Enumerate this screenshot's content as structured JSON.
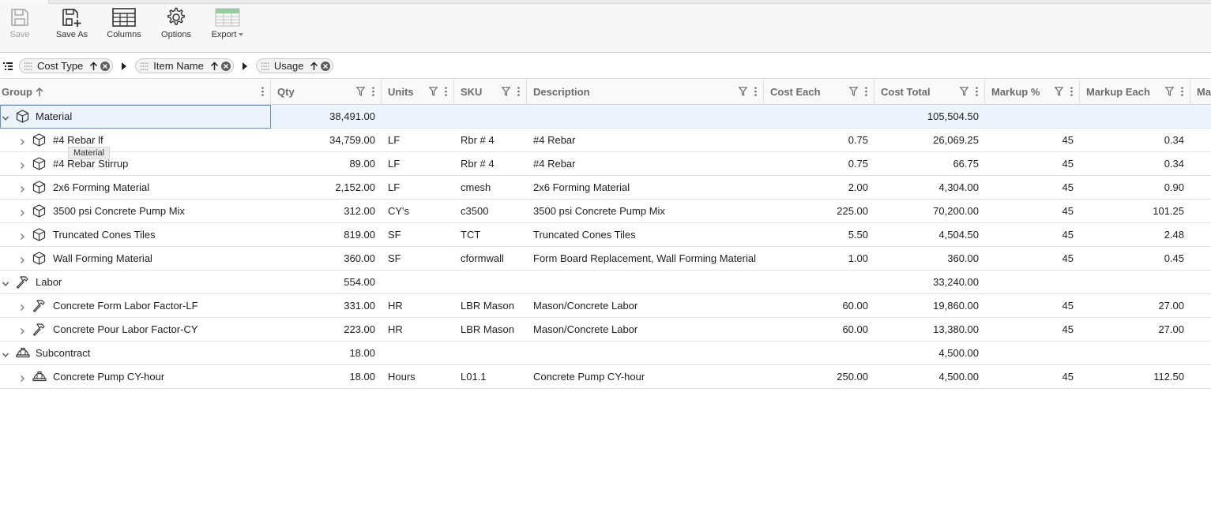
{
  "toolbar": {
    "save": "Save",
    "save_as": "Save As",
    "columns": "Columns",
    "options": "Options",
    "export": "Export"
  },
  "grouping": {
    "chips": [
      {
        "label": "Cost Type"
      },
      {
        "label": "Item Name"
      },
      {
        "label": "Usage"
      }
    ]
  },
  "columns": {
    "group": "Group",
    "qty": "Qty",
    "units": "Units",
    "sku": "SKU",
    "description": "Description",
    "cost_each": "Cost Each",
    "cost_total": "Cost Total",
    "markup_pct": "Markup %",
    "markup_each": "Markup Each",
    "next": "Ma"
  },
  "tooltip": "Material",
  "rows": [
    {
      "type": "group",
      "icon": "box-icon",
      "name": "Material",
      "qty": "38,491.00",
      "cost_total": "105,504.50"
    },
    {
      "type": "item",
      "icon": "box-icon",
      "name": "#4 Rebar lf",
      "qty": "34,759.00",
      "units": "LF",
      "sku": "Rbr # 4",
      "description": "#4 Rebar",
      "cost_each": "0.75",
      "cost_total": "26,069.25",
      "markup_pct": "45",
      "markup_each": "0.34"
    },
    {
      "type": "item",
      "icon": "box-icon",
      "name": "#4 Rebar Stirrup",
      "qty": "89.00",
      "units": "LF",
      "sku": "Rbr # 4",
      "description": "#4 Rebar",
      "cost_each": "0.75",
      "cost_total": "66.75",
      "markup_pct": "45",
      "markup_each": "0.34"
    },
    {
      "type": "item",
      "icon": "box-icon",
      "name": "2x6 Forming Material",
      "qty": "2,152.00",
      "units": "LF",
      "sku": "cmesh",
      "description": "2x6 Forming Material",
      "cost_each": "2.00",
      "cost_total": "4,304.00",
      "markup_pct": "45",
      "markup_each": "0.90"
    },
    {
      "type": "item",
      "icon": "box-icon",
      "name": "3500 psi Concrete Pump Mix",
      "qty": "312.00",
      "units": "CY's",
      "sku": "c3500",
      "description": "3500 psi Concrete Pump Mix",
      "cost_each": "225.00",
      "cost_total": "70,200.00",
      "markup_pct": "45",
      "markup_each": "101.25"
    },
    {
      "type": "item",
      "icon": "box-icon",
      "name": "Truncated Cones Tiles",
      "qty": "819.00",
      "units": "SF",
      "sku": "TCT",
      "description": "Truncated Cones Tiles",
      "cost_each": "5.50",
      "cost_total": "4,504.50",
      "markup_pct": "45",
      "markup_each": "2.48"
    },
    {
      "type": "item",
      "icon": "box-icon",
      "name": "Wall Forming Material",
      "qty": "360.00",
      "units": "SF",
      "sku": "cformwall",
      "description": "Form Board Replacement, Wall Forming Material",
      "cost_each": "1.00",
      "cost_total": "360.00",
      "markup_pct": "45",
      "markup_each": "0.45"
    },
    {
      "type": "group",
      "icon": "hammer-icon",
      "name": "Labor",
      "qty": "554.00",
      "cost_total": "33,240.00"
    },
    {
      "type": "item",
      "icon": "hammer-icon",
      "name": "Concrete Form Labor Factor-LF",
      "qty": "331.00",
      "units": "HR",
      "sku": "LBR Mason",
      "description": "Mason/Concrete Labor",
      "cost_each": "60.00",
      "cost_total": "19,860.00",
      "markup_pct": "45",
      "markup_each": "27.00"
    },
    {
      "type": "item",
      "icon": "hammer-icon",
      "name": "Concrete Pour Labor Factor-CY",
      "qty": "223.00",
      "units": "HR",
      "sku": "LBR Mason",
      "description": "Mason/Concrete Labor",
      "cost_each": "60.00",
      "cost_total": "13,380.00",
      "markup_pct": "45",
      "markup_each": "27.00"
    },
    {
      "type": "group",
      "icon": "hardhat-icon",
      "name": "Subcontract",
      "qty": "18.00",
      "cost_total": "4,500.00"
    },
    {
      "type": "item",
      "icon": "hardhat-icon",
      "name": "Concrete Pump CY-hour",
      "qty": "18.00",
      "units": "Hours",
      "sku": "L01.1",
      "description": "Concrete Pump CY-hour",
      "cost_each": "250.00",
      "cost_total": "4,500.00",
      "markup_pct": "45",
      "markup_each": "112.50"
    }
  ]
}
